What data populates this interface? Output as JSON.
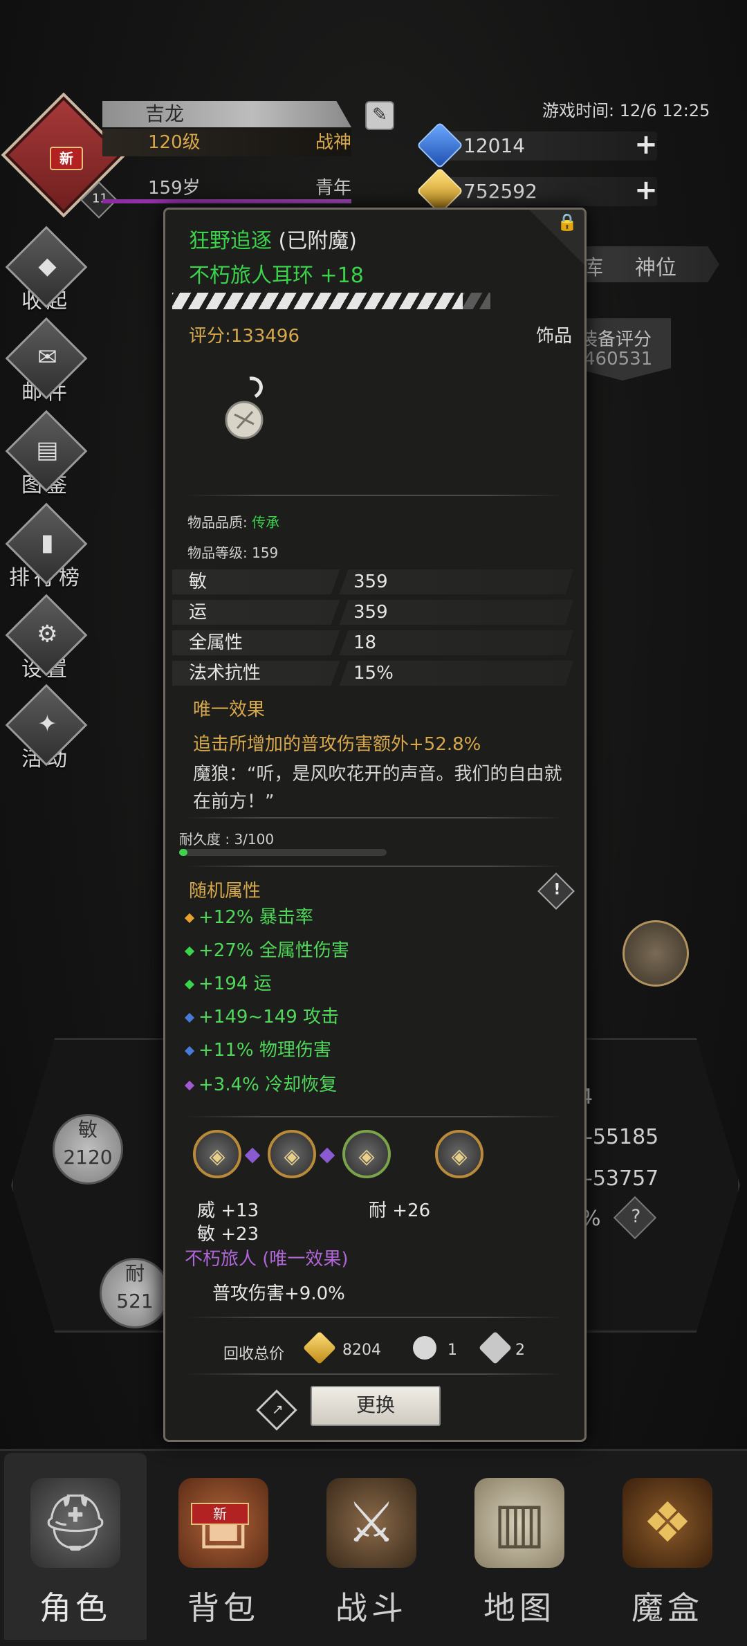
{
  "header": {
    "player_name": "吉龙",
    "level": "120级",
    "title": "战神",
    "age": "159岁",
    "age_stage": "青年",
    "avatar_badge": "新",
    "avatar_level_badge": "11",
    "game_time": "游戏时间: 12/6 12:25",
    "currency_blue": "12014",
    "currency_gold": "752592"
  },
  "side_menu": [
    {
      "label": "收起",
      "icon": "collapse-icon"
    },
    {
      "label": "邮件",
      "icon": "mail-icon"
    },
    {
      "label": "图鉴",
      "icon": "book-icon"
    },
    {
      "label": "排行榜",
      "icon": "leaderboard-icon"
    },
    {
      "label": "设置",
      "icon": "gear-icon"
    },
    {
      "label": "活动",
      "icon": "event-icon"
    }
  ],
  "background": {
    "tab_ku": "库",
    "tab_shen": "神位",
    "score_label": "装备评分",
    "score_value": "460531",
    "stat_min": "敏",
    "stat_min_val": "2120",
    "stat_nai": "耐",
    "stat_nai_val": "521",
    "num1": "-55185",
    "num2": "-53757",
    "num3": "4",
    "pct": "%"
  },
  "item": {
    "enchant_name": "狂野追逐",
    "enchant_tag": "(已附魔)",
    "name": "不朽旅人耳环 +18",
    "score": "评分:133496",
    "category": "饰品",
    "quality_label": "物品品质: ",
    "quality_value": "传承",
    "item_level": "物品等级: 159",
    "stats": [
      {
        "key": "敏",
        "value": "359"
      },
      {
        "key": "运",
        "value": "359"
      },
      {
        "key": "全属性",
        "value": "18"
      },
      {
        "key": "法术抗性",
        "value": "15%"
      }
    ],
    "unique_title": "唯一效果",
    "unique_effect": "追击所增加的普攻伤害额外+52.8%",
    "lore": "魔狼：“听，是风吹花开的声音。我们的自由就在前方！”",
    "durability_label": "耐久度 : 3/100",
    "durability_fraction": 0.03,
    "random_title": "随机属性",
    "affixes": [
      {
        "value": "+12%",
        "name": "暴击率",
        "color": "#e8a030"
      },
      {
        "value": "+27%",
        "name": "全属性伤害",
        "color": "#3bd34b"
      },
      {
        "value": "+194",
        "name": "运",
        "color": "#3bd34b"
      },
      {
        "value": "+149~149",
        "name": "攻击",
        "color": "#4a7ad8"
      },
      {
        "value": "+11%",
        "name": "物理伤害",
        "color": "#4a7ad8"
      },
      {
        "value": "+3.4%",
        "name": "冷却恢复",
        "color": "#a05ad0"
      }
    ],
    "socket_stats": {
      "wei": "威 +13",
      "min": "敏 +23",
      "nai": "耐 +26"
    },
    "set_name": "不朽旅人 (唯一效果)",
    "set_effect": "普攻伤害+9.0%",
    "recycle_label": "回收总价",
    "recycle_gold": "8204",
    "recycle_item1": "1",
    "recycle_item2": "2",
    "swap_button": "更换"
  },
  "bottom_nav": [
    {
      "label": "角色",
      "icon": "helmet-icon",
      "active": true
    },
    {
      "label": "背包",
      "icon": "backpack-icon",
      "badge": "新"
    },
    {
      "label": "战斗",
      "icon": "sword-shield-icon"
    },
    {
      "label": "地图",
      "icon": "scroll-map-icon"
    },
    {
      "label": "魔盒",
      "icon": "magic-box-icon"
    }
  ]
}
